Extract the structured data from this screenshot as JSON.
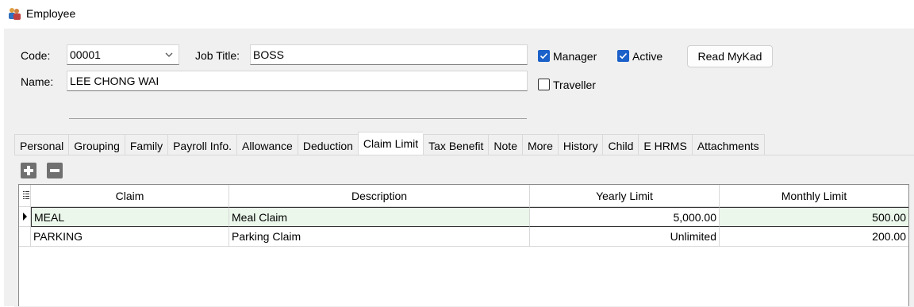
{
  "window": {
    "title": "Employee"
  },
  "form": {
    "code_label": "Code:",
    "code_value": "00001",
    "job_title_label": "Job Title:",
    "job_title_value": "BOSS",
    "name_label": "Name:",
    "name_value": "LEE CHONG WAI",
    "manager_label": "Manager",
    "manager_checked": true,
    "active_label": "Active",
    "active_checked": true,
    "traveller_label": "Traveller",
    "traveller_checked": false,
    "read_mykad_label": "Read MyKad"
  },
  "tabs": [
    {
      "label": "Personal",
      "active": false
    },
    {
      "label": "Grouping",
      "active": false
    },
    {
      "label": "Family",
      "active": false
    },
    {
      "label": "Payroll Info.",
      "active": false
    },
    {
      "label": "Allowance",
      "active": false
    },
    {
      "label": "Deduction",
      "active": false
    },
    {
      "label": "Claim Limit",
      "active": true
    },
    {
      "label": "Tax Benefit",
      "active": false
    },
    {
      "label": "Note",
      "active": false
    },
    {
      "label": "More",
      "active": false
    },
    {
      "label": "History",
      "active": false
    },
    {
      "label": "Child",
      "active": false
    },
    {
      "label": "E HRMS",
      "active": false
    },
    {
      "label": "Attachments",
      "active": false
    }
  ],
  "grid": {
    "columns": [
      "Claim",
      "Description",
      "Yearly Limit",
      "Monthly Limit"
    ],
    "rows": [
      {
        "claim": "MEAL",
        "description": "Meal Claim",
        "yearly": "5,000.00",
        "monthly": "500.00",
        "selected": true
      },
      {
        "claim": "PARKING",
        "description": "Parking Claim",
        "yearly": "Unlimited",
        "monthly": "200.00",
        "selected": false
      }
    ]
  },
  "colors": {
    "checkbox_on": "#1b61c9",
    "selected_row": "#eaf7ea",
    "form_bg": "#f0f0f0"
  },
  "icons": {
    "app": "employees-icon",
    "add": "plus-icon",
    "remove": "minus-icon",
    "combo": "chevron-down-icon",
    "row_pointer": "row-pointer-icon",
    "column_menu": "column-chooser-icon"
  }
}
